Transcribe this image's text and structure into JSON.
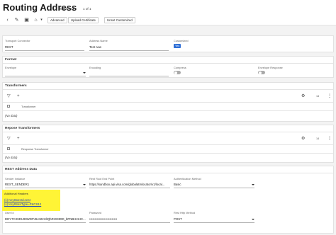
{
  "header": {
    "title": "Routing Address",
    "selection": "Test new",
    "pager": "1 of 1"
  },
  "toolbar": {
    "buttons": [
      "Advanced",
      "Upload Certificate",
      "Unset Customized"
    ]
  },
  "general": {
    "transport_connector": {
      "label": "Transport Connector",
      "value": "REST"
    },
    "address_name": {
      "label": "Address Name",
      "value": "Test new"
    },
    "customized": {
      "label": "Customized",
      "value": "Yes"
    }
  },
  "format": {
    "title": "Format",
    "envelope": {
      "label": "Envelope",
      "value": ""
    },
    "encoding": {
      "label": "Encoding",
      "value": ""
    },
    "compress": {
      "label": "Compress"
    },
    "envelope_response": {
      "label": "Envelope Response"
    }
  },
  "transformers": {
    "title": "Transformers",
    "column": "Transformer",
    "empty": "(No data)",
    "count": "14"
  },
  "response_transformers": {
    "title": "Repose Transformers",
    "column": "Response Transformer",
    "empty": "(No data)",
    "count": "14"
  },
  "rest": {
    "title": "REST Address Data",
    "sender_instance": {
      "label": "Sender Instance",
      "value": "REST_SENDER1"
    },
    "root_endpoint": {
      "label": "Rest Root End Point",
      "value": "https://sandbox.api.visa.com/globalatmlocator/v1/local..."
    },
    "auth_method": {
      "label": "Authentication Method",
      "value": "Basic"
    },
    "additional_headers": {
      "label": "Additional Headers",
      "items": [
        "(s) KeyStoreId=test",
        "(s) KeyStoreType=PKCS12"
      ]
    },
    "user_id": {
      "label": "User Id",
      "value": "DDY7C3SDU99WDPJ6J422HlIQbRzW3DD_bPNBHI4HC..."
    },
    "password": {
      "label": "Password",
      "value": "••••••••••••••••••••••••••"
    },
    "http_method": {
      "label": "Rest Http Method",
      "value": "POST"
    }
  },
  "colors": {
    "accent": "#2f6fd6",
    "highlight": "#fff436",
    "link": "#1b3fc2"
  }
}
